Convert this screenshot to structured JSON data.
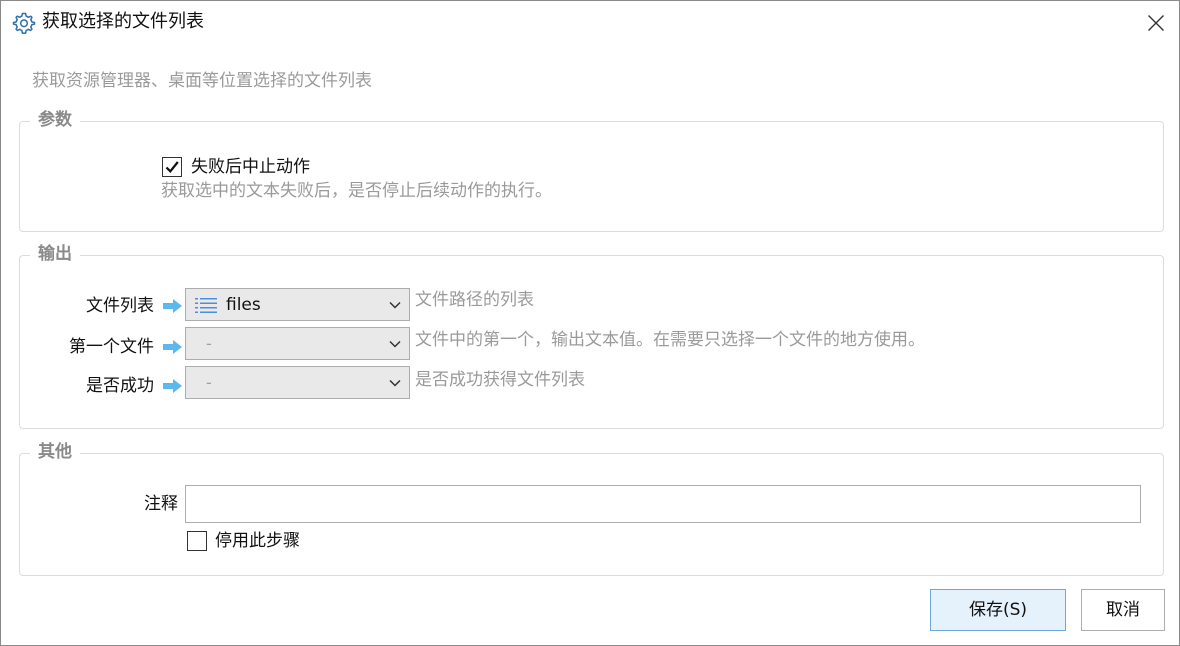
{
  "window": {
    "title": "获取选择的文件列表",
    "subtitle": "获取资源管理器、桌面等位置选择的文件列表"
  },
  "params": {
    "legend": "参数",
    "stop_on_fail": {
      "label": "失败后中止动作",
      "checked": true
    },
    "stop_on_fail_hint": "获取选中的文本失败后，是否停止后续动作的执行。"
  },
  "output": {
    "legend": "输出",
    "rows": [
      {
        "label": "文件列表",
        "value": "files",
        "icon": "list-icon",
        "hint": "文件路径的列表"
      },
      {
        "label": "第一个文件",
        "value": "-",
        "hint": "文件中的第一个，输出文本值。在需要只选择一个文件的地方使用。"
      },
      {
        "label": "是否成功",
        "value": "-",
        "hint": "是否成功获得文件列表"
      }
    ]
  },
  "other": {
    "legend": "其他",
    "note_label": "注释",
    "note_value": "",
    "disable_step": {
      "label": "停用此步骤",
      "checked": false
    }
  },
  "buttons": {
    "save": "保存(S)",
    "cancel": "取消"
  },
  "colors": {
    "arrow": "#5bb8f0",
    "save_border": "#6fa8dc",
    "save_bg": "#e5f1fb",
    "hint": "#9a9a9a",
    "legend": "#8a8a8a"
  }
}
